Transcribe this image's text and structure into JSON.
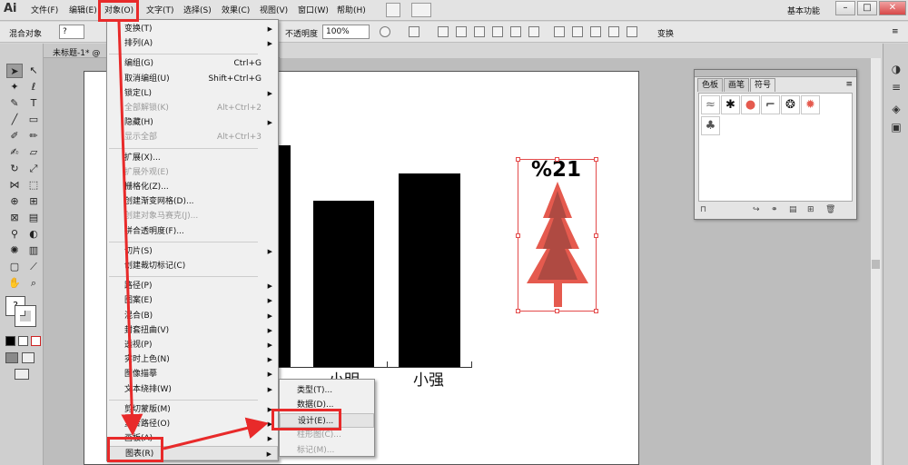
{
  "app": {
    "logo": "Ai"
  },
  "menubar": {
    "items": [
      "文件(F)",
      "编辑(E)",
      "对象(O)",
      "文字(T)",
      "选择(S)",
      "效果(C)",
      "视图(V)",
      "窗口(W)",
      "帮助(H)"
    ],
    "workspace": "基本功能"
  },
  "control_bar": {
    "group_label": "混合对象",
    "fill_value": "?",
    "opacity_label": "不透明度",
    "opacity_value": "100%",
    "transform_label": "变换"
  },
  "document_tab": {
    "title": "未标题-1* @"
  },
  "object_menu": {
    "items": [
      {
        "label": "变换(T)",
        "submenu": true
      },
      {
        "label": "排列(A)",
        "submenu": true
      },
      {
        "sep": true
      },
      {
        "label": "编组(G)",
        "shortcut": "Ctrl+G"
      },
      {
        "label": "取消编组(U)",
        "shortcut": "Shift+Ctrl+G"
      },
      {
        "label": "锁定(L)",
        "submenu": true
      },
      {
        "label": "全部解锁(K)",
        "shortcut": "Alt+Ctrl+2",
        "disabled": true
      },
      {
        "label": "隐藏(H)",
        "submenu": true
      },
      {
        "label": "显示全部",
        "shortcut": "Alt+Ctrl+3",
        "disabled": true
      },
      {
        "sep": true
      },
      {
        "label": "扩展(X)..."
      },
      {
        "label": "扩展外观(E)",
        "disabled": true
      },
      {
        "label": "栅格化(Z)..."
      },
      {
        "label": "创建渐变网格(D)..."
      },
      {
        "label": "创建对象马赛克(J)...",
        "disabled": true
      },
      {
        "label": "拼合透明度(F)..."
      },
      {
        "sep": true
      },
      {
        "label": "切片(S)",
        "submenu": true
      },
      {
        "label": "创建裁切标记(C)"
      },
      {
        "sep": true
      },
      {
        "label": "路径(P)",
        "submenu": true
      },
      {
        "label": "图案(E)",
        "submenu": true
      },
      {
        "label": "混合(B)",
        "submenu": true
      },
      {
        "label": "封套扭曲(V)",
        "submenu": true
      },
      {
        "label": "透视(P)",
        "submenu": true
      },
      {
        "label": "实时上色(N)",
        "submenu": true
      },
      {
        "label": "图像描摹",
        "submenu": true
      },
      {
        "label": "文本绕排(W)",
        "submenu": true
      },
      {
        "sep": true
      },
      {
        "label": "剪切蒙版(M)",
        "submenu": true
      },
      {
        "label": "复合路径(O)",
        "submenu": true
      },
      {
        "label": "画板(A)",
        "submenu": true
      },
      {
        "label": "图表(R)",
        "submenu": true,
        "highlight": true
      }
    ]
  },
  "chart_submenu": {
    "items": [
      {
        "label": "类型(T)..."
      },
      {
        "label": "数据(D)..."
      },
      {
        "label": "设计(E)...",
        "highlight": true
      },
      {
        "label": "柱形图(C)...",
        "disabled": true
      },
      {
        "label": "标记(M)...",
        "disabled": true
      }
    ]
  },
  "chart": {
    "categories": [
      "小明",
      "小强"
    ],
    "tree_label": "%21"
  },
  "panel": {
    "tabs": [
      "色板",
      "画笔",
      "符号"
    ],
    "active_tab": "符号"
  }
}
